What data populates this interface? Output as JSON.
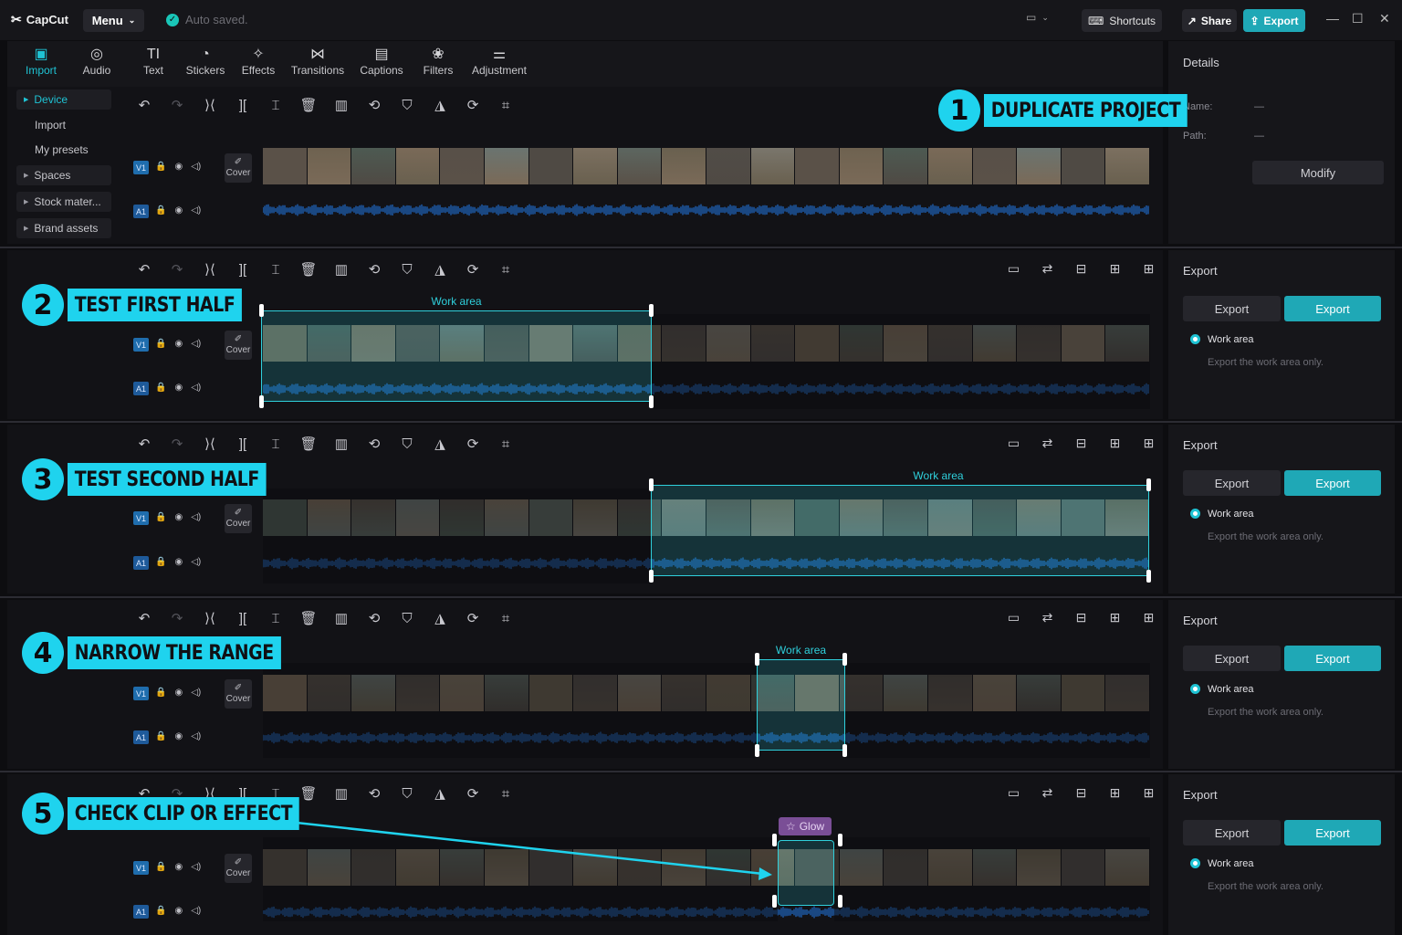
{
  "app": {
    "name": "CapCut",
    "menu_label": "Menu",
    "autosave": "Auto saved.",
    "shortcuts_label": "Shortcuts",
    "share_label": "Share",
    "export_label": "Export"
  },
  "media_tabs": [
    {
      "label": "Import",
      "icon": "import-icon"
    },
    {
      "label": "Audio",
      "icon": "audio-icon"
    },
    {
      "label": "Text",
      "icon": "text-icon"
    },
    {
      "label": "Stickers",
      "icon": "stickers-icon"
    },
    {
      "label": "Effects",
      "icon": "effects-icon"
    },
    {
      "label": "Transitions",
      "icon": "transitions-icon"
    },
    {
      "label": "Captions",
      "icon": "captions-icon"
    },
    {
      "label": "Filters",
      "icon": "filters-icon"
    },
    {
      "label": "Adjustment",
      "icon": "adjustment-icon"
    }
  ],
  "sidebar": {
    "items": [
      {
        "label": "Device"
      },
      {
        "label": "Import"
      },
      {
        "label": "My presets"
      },
      {
        "label": "Spaces"
      },
      {
        "label": "Stock mater..."
      },
      {
        "label": "Brand assets"
      }
    ]
  },
  "details": {
    "title": "Details",
    "name_label": "Name:",
    "name_value": "—",
    "path_label": "Path:",
    "path_value": "—",
    "modify_label": "Modify"
  },
  "tracks": {
    "video": "V1",
    "audio": "A1",
    "cover": "Cover"
  },
  "workarea_label": "Work area",
  "export_panel": {
    "title": "Export",
    "btn_left": "Export",
    "btn_right": "Export",
    "option": "Work area",
    "desc": "Export the work area only."
  },
  "steps": [
    {
      "num": "1",
      "text": "DUPLICATE PROJECT"
    },
    {
      "num": "2",
      "text": "TEST FIRST HALF"
    },
    {
      "num": "3",
      "text": "TEST SECOND HALF"
    },
    {
      "num": "4",
      "text": "NARROW THE RANGE"
    },
    {
      "num": "5",
      "text": "CHECK CLIP OR EFFECT"
    }
  ],
  "effect_tag": "Glow",
  "colors": {
    "accent": "#1fd3ee",
    "export": "#1fa8b6",
    "workarea": "#2fd0dc",
    "effect": "#7a4e96",
    "audio_wave": "#1f5fb0"
  }
}
